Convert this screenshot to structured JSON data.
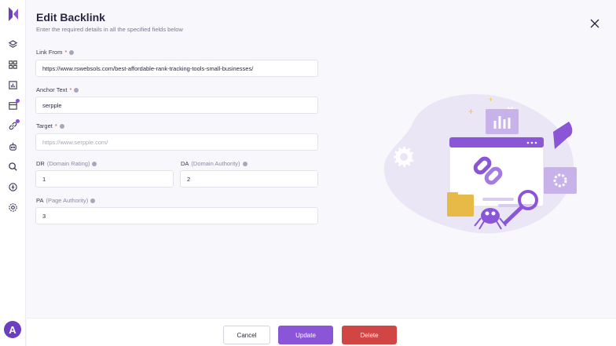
{
  "header": {
    "title": "Edit Backlink",
    "subtitle": "Enter the required details in all the specified fields below"
  },
  "sidebar": {
    "logo_icon": "logo-icon",
    "items": [
      {
        "icon": "layers-icon",
        "active": false
      },
      {
        "icon": "grid-icon",
        "active": false
      },
      {
        "icon": "bar-chart-icon",
        "active": false
      },
      {
        "icon": "calendar-icon",
        "active": true
      },
      {
        "icon": "link-icon",
        "active": true
      },
      {
        "icon": "robot-icon",
        "active": false
      },
      {
        "icon": "search-icon",
        "active": false
      },
      {
        "icon": "globe-icon",
        "active": false
      },
      {
        "icon": "settings-icon",
        "active": false
      }
    ],
    "avatar_initial": "A"
  },
  "form": {
    "link_from": {
      "label": "Link From",
      "required_mark": "*",
      "value": "https://www.rswebsols.com/best-affordable-rank-tracking-tools-small-businesses/"
    },
    "anchor_text": {
      "label": "Anchor Text",
      "required_mark": "*",
      "value": "serpple"
    },
    "target": {
      "label": "Target",
      "required_mark": "*",
      "value": "",
      "placeholder": "https://www.serpple.com/"
    },
    "dr": {
      "label": "DR",
      "hint": "(Domain Rating)",
      "value": "1"
    },
    "da": {
      "label": "DA",
      "hint": "(Domain Authority)",
      "value": "2"
    },
    "pa": {
      "label": "PA",
      "hint": "(Page Authority)",
      "value": "3"
    }
  },
  "footer": {
    "cancel_label": "Cancel",
    "update_label": "Update",
    "delete_label": "Delete"
  },
  "colors": {
    "accent": "#8a55d6",
    "danger": "#d24545",
    "avatar": "#6b3fc0"
  }
}
